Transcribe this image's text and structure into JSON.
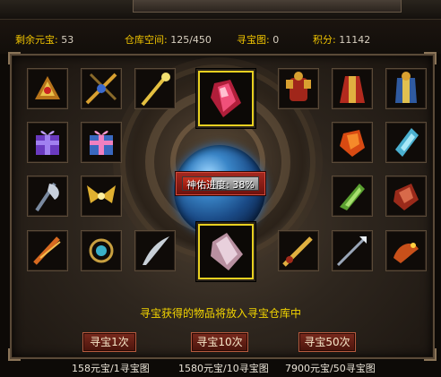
{
  "stats": {
    "yuanbao_label": "剩余元宝:",
    "yuanbao_value": "53",
    "storage_label": "仓库空间:",
    "storage_value": "125/450",
    "map_label": "寻宝图:",
    "map_value": "0",
    "points_label": "积分:",
    "points_value": "11142"
  },
  "progress": {
    "label": "神佑进度: 38%",
    "value_percent": 38
  },
  "notice": "寻宝获得的物品将放入寻宝仓库中",
  "buttons": [
    {
      "label": "寻宝1次",
      "cost": "158元宝/1寻宝图"
    },
    {
      "label": "寻宝10次",
      "cost": "1580元宝/10寻宝图"
    },
    {
      "label": "寻宝50次",
      "cost": "7900元宝/50寻宝图"
    }
  ],
  "items": [
    "gold-wing-ornament-icon",
    "crossed-spear-icon",
    "golden-staff-icon",
    "armor-set-icon",
    "red-robe-icon",
    "blue-armor-icon",
    "purple-gift-box-icon",
    "pink-gift-box-icon",
    "orange-gem-icon",
    "blue-gem-icon",
    "silver-axe-icon",
    "golden-wings-icon",
    "green-gem-icon",
    "red-gem-icon",
    "fire-blade-icon",
    "blue-jade-pendant-icon",
    "curved-blade-icon",
    "golden-blade-icon",
    "silver-spear-icon",
    "fire-dragon-icon"
  ],
  "featured_items": [
    "red-crystal-icon",
    "pink-crystal-icon"
  ],
  "colors": {
    "label_yellow": "#f0c400",
    "highlight_border": "#e8d020",
    "button_red": "#7a2a1d"
  }
}
